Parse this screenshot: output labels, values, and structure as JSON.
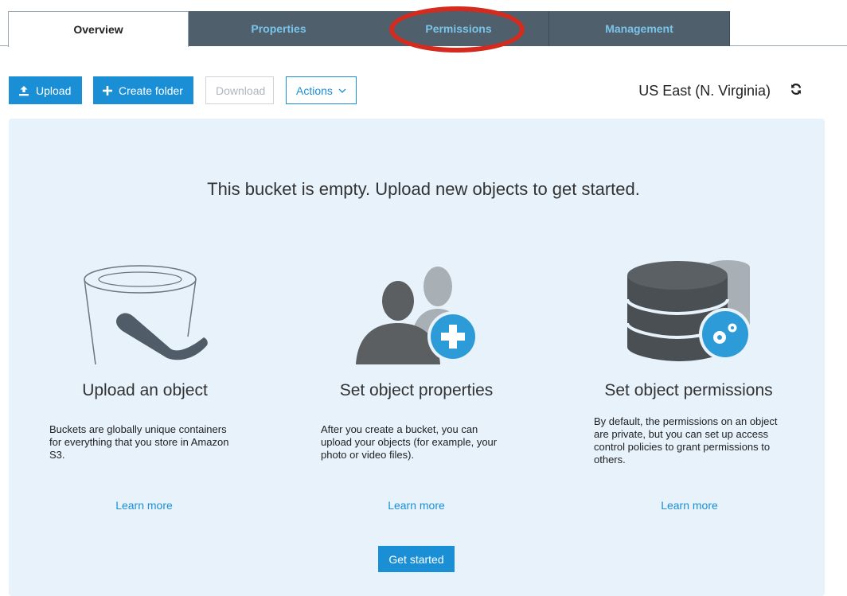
{
  "tabs": [
    {
      "label": "Overview",
      "active": true
    },
    {
      "label": "Properties",
      "active": false
    },
    {
      "label": "Permissions",
      "active": false,
      "highlighted": true
    },
    {
      "label": "Management",
      "active": false
    }
  ],
  "toolbar": {
    "upload_label": "Upload",
    "create_folder_label": "Create folder",
    "download_label": "Download",
    "actions_label": "Actions",
    "region": "US East (N. Virginia)"
  },
  "empty_state": {
    "headline": "This bucket is empty. Upload new objects to get started.",
    "columns": [
      {
        "title": "Upload an object",
        "description": "Buckets are globally unique containers for everything that you store in Amazon S3.",
        "link": "Learn more",
        "icon": "bucket-icon"
      },
      {
        "title": "Set object properties",
        "description": "After you create a bucket, you can upload your objects (for example, your photo or video files).",
        "link": "Learn more",
        "icon": "users-add-icon"
      },
      {
        "title": "Set object permissions",
        "description": "By default, the permissions on an object are private, but you can set up access control policies to grant permissions to others.",
        "link": "Learn more",
        "icon": "database-settings-icon"
      }
    ],
    "cta_label": "Get started"
  },
  "colors": {
    "accent": "#1a8fd6",
    "tab_dark": "#4f5f6b",
    "tab_text": "#79c4ea",
    "panel_bg": "#e7f2fb",
    "highlight": "#d42b1e"
  }
}
